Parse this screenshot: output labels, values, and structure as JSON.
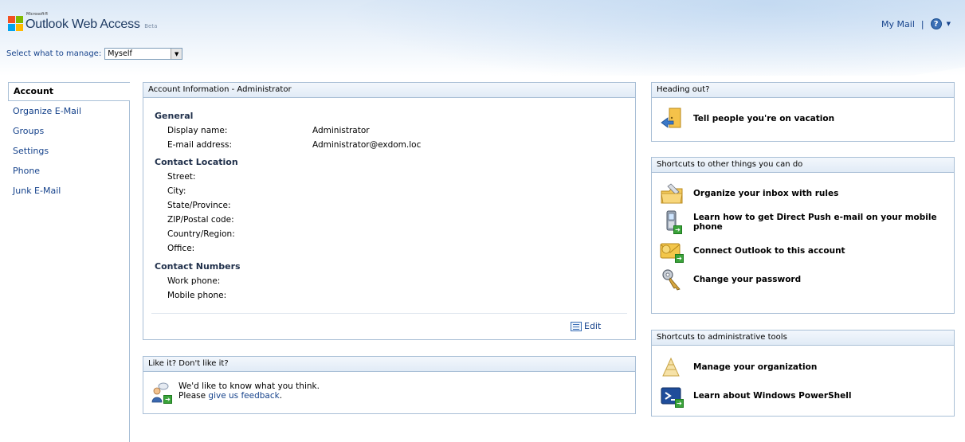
{
  "header": {
    "brand_small": "Microsoft®",
    "app_title": "Outlook Web Access",
    "app_beta": "Beta",
    "manage_label": "Select what to manage:",
    "manage_value": "Myself",
    "my_mail": "My Mail",
    "separator": "|",
    "help_glyph": "?",
    "help_icon": "help-icon",
    "caret_icon": "chevron-down-icon"
  },
  "nav": {
    "items": [
      {
        "label": "Account",
        "active": true
      },
      {
        "label": "Organize E-Mail"
      },
      {
        "label": "Groups"
      },
      {
        "label": "Settings"
      },
      {
        "label": "Phone"
      },
      {
        "label": "Junk E-Mail"
      }
    ]
  },
  "account": {
    "title": "Account Information - Administrator",
    "general": "General",
    "display_name_label": "Display name:",
    "display_name_value": "Administrator",
    "email_label": "E-mail address:",
    "email_value": "Administrator@exdom.loc",
    "contact_location": "Contact Location",
    "street": "Street:",
    "city": "City:",
    "state": "State/Province:",
    "zip": "ZIP/Postal code:",
    "country": "Country/Region:",
    "office": "Office:",
    "contact_numbers": "Contact Numbers",
    "work_phone": "Work phone:",
    "mobile_phone": "Mobile phone:",
    "edit": "Edit"
  },
  "feedback": {
    "title": "Like it? Don't like it?",
    "line1": "We'd like to know what you think.",
    "line2_prefix": "Please ",
    "line2_link": "give us feedback",
    "line2_suffix": "."
  },
  "heading_out": {
    "title": "Heading out?",
    "vacation": "Tell people you're on vacation"
  },
  "shortcuts": {
    "title": "Shortcuts to other things you can do",
    "items": [
      {
        "label": "Organize your inbox with rules",
        "icon": "folder-rules-icon"
      },
      {
        "label": "Learn how to get Direct Push e-mail on your mobile phone",
        "icon": "mobile-phone-icon"
      },
      {
        "label": "Connect Outlook to this account",
        "icon": "outlook-connect-icon"
      },
      {
        "label": "Change your password",
        "icon": "key-icon"
      }
    ]
  },
  "admin": {
    "title": "Shortcuts to administrative tools",
    "items": [
      {
        "label": "Manage your organization",
        "icon": "manage-organization-icon"
      },
      {
        "label": "Learn about Windows PowerShell",
        "icon": "powershell-icon"
      }
    ]
  }
}
